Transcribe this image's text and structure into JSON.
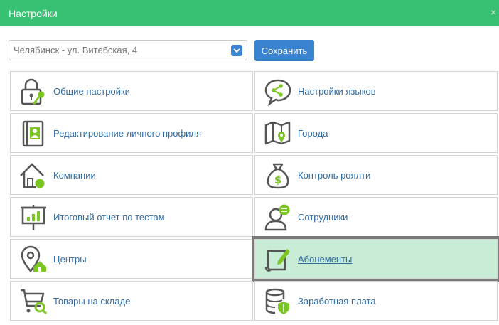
{
  "window": {
    "title": "Настройки"
  },
  "toolbar": {
    "location_value": "Челябинск - ул. Витебская, 4",
    "save_label": "Сохранить"
  },
  "tiles": [
    {
      "label": "Общие настройки",
      "icon": "lock-key-icon"
    },
    {
      "label": "Настройки языков",
      "icon": "chat-share-icon"
    },
    {
      "label": "Редактирование личного профиля",
      "icon": "profile-book-icon"
    },
    {
      "label": "Города",
      "icon": "map-pin-icon"
    },
    {
      "label": "Компании",
      "icon": "house-icon"
    },
    {
      "label": "Контроль роялти",
      "icon": "money-bag-icon"
    },
    {
      "label": "Итоговый отчет по тестам",
      "icon": "report-chart-icon"
    },
    {
      "label": "Сотрудники",
      "icon": "employee-chat-icon"
    },
    {
      "label": "Центры",
      "icon": "location-home-icon"
    },
    {
      "label": "Абонементы",
      "icon": "subscription-edit-icon",
      "selected": true
    },
    {
      "label": "Товары на складе",
      "icon": "cart-search-icon"
    },
    {
      "label": "Заработная плата",
      "icon": "database-shield-icon"
    }
  ],
  "colors": {
    "header": "#38c172",
    "accent": "#3a83d1",
    "icon_gray": "#555555",
    "icon_green": "#7cc624",
    "selected_bg": "#c9ecd6"
  }
}
